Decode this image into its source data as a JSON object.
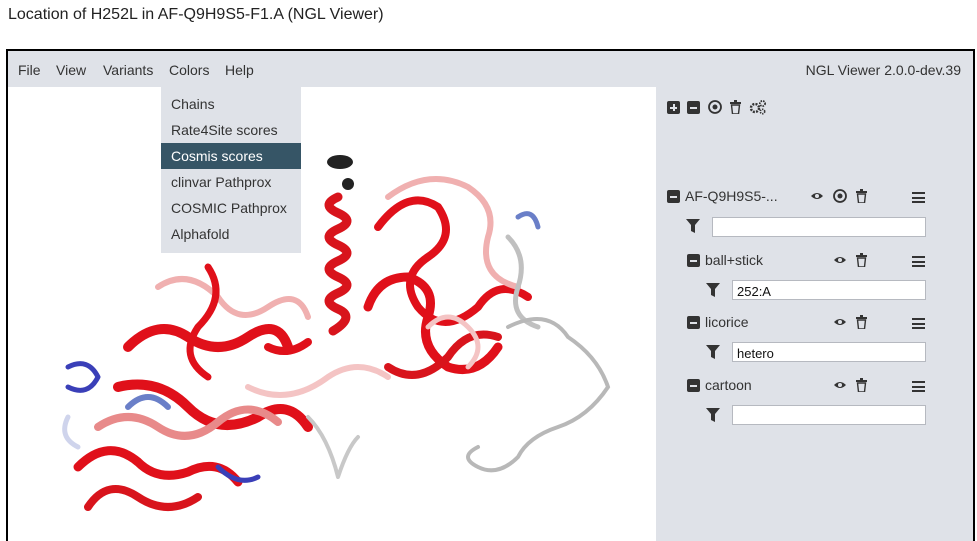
{
  "page_title": "Location of H252L in AF-Q9H9S5-F1.A (NGL Viewer)",
  "menubar": {
    "items": [
      "File",
      "View",
      "Variants",
      "Colors",
      "Help"
    ],
    "version": "NGL Viewer 2.0.0-dev.39"
  },
  "colors_menu": {
    "items": [
      "Chains",
      "Rate4Site scores",
      "Cosmis scores",
      "clinvar Pathprox",
      "COSMIC Pathprox",
      "Alphafold"
    ],
    "active": "Cosmis scores"
  },
  "toolbar_icons": [
    "plus-square-icon",
    "minus-square-icon",
    "bullseye-icon",
    "trash-icon",
    "cogs-icon"
  ],
  "component": {
    "name": "AF-Q9H9S5-...",
    "filter_value": ""
  },
  "representations": [
    {
      "name": "ball+stick",
      "selection": "252:A"
    },
    {
      "name": "licorice",
      "selection": "hetero"
    },
    {
      "name": "cartoon",
      "selection": ""
    }
  ],
  "colors": {
    "panel_bg": "#dfe2e8",
    "menu_active": "#365566",
    "high_score": "#e0101a",
    "low_score": "#3a3fb8",
    "neutral": "#c8c8c8"
  }
}
